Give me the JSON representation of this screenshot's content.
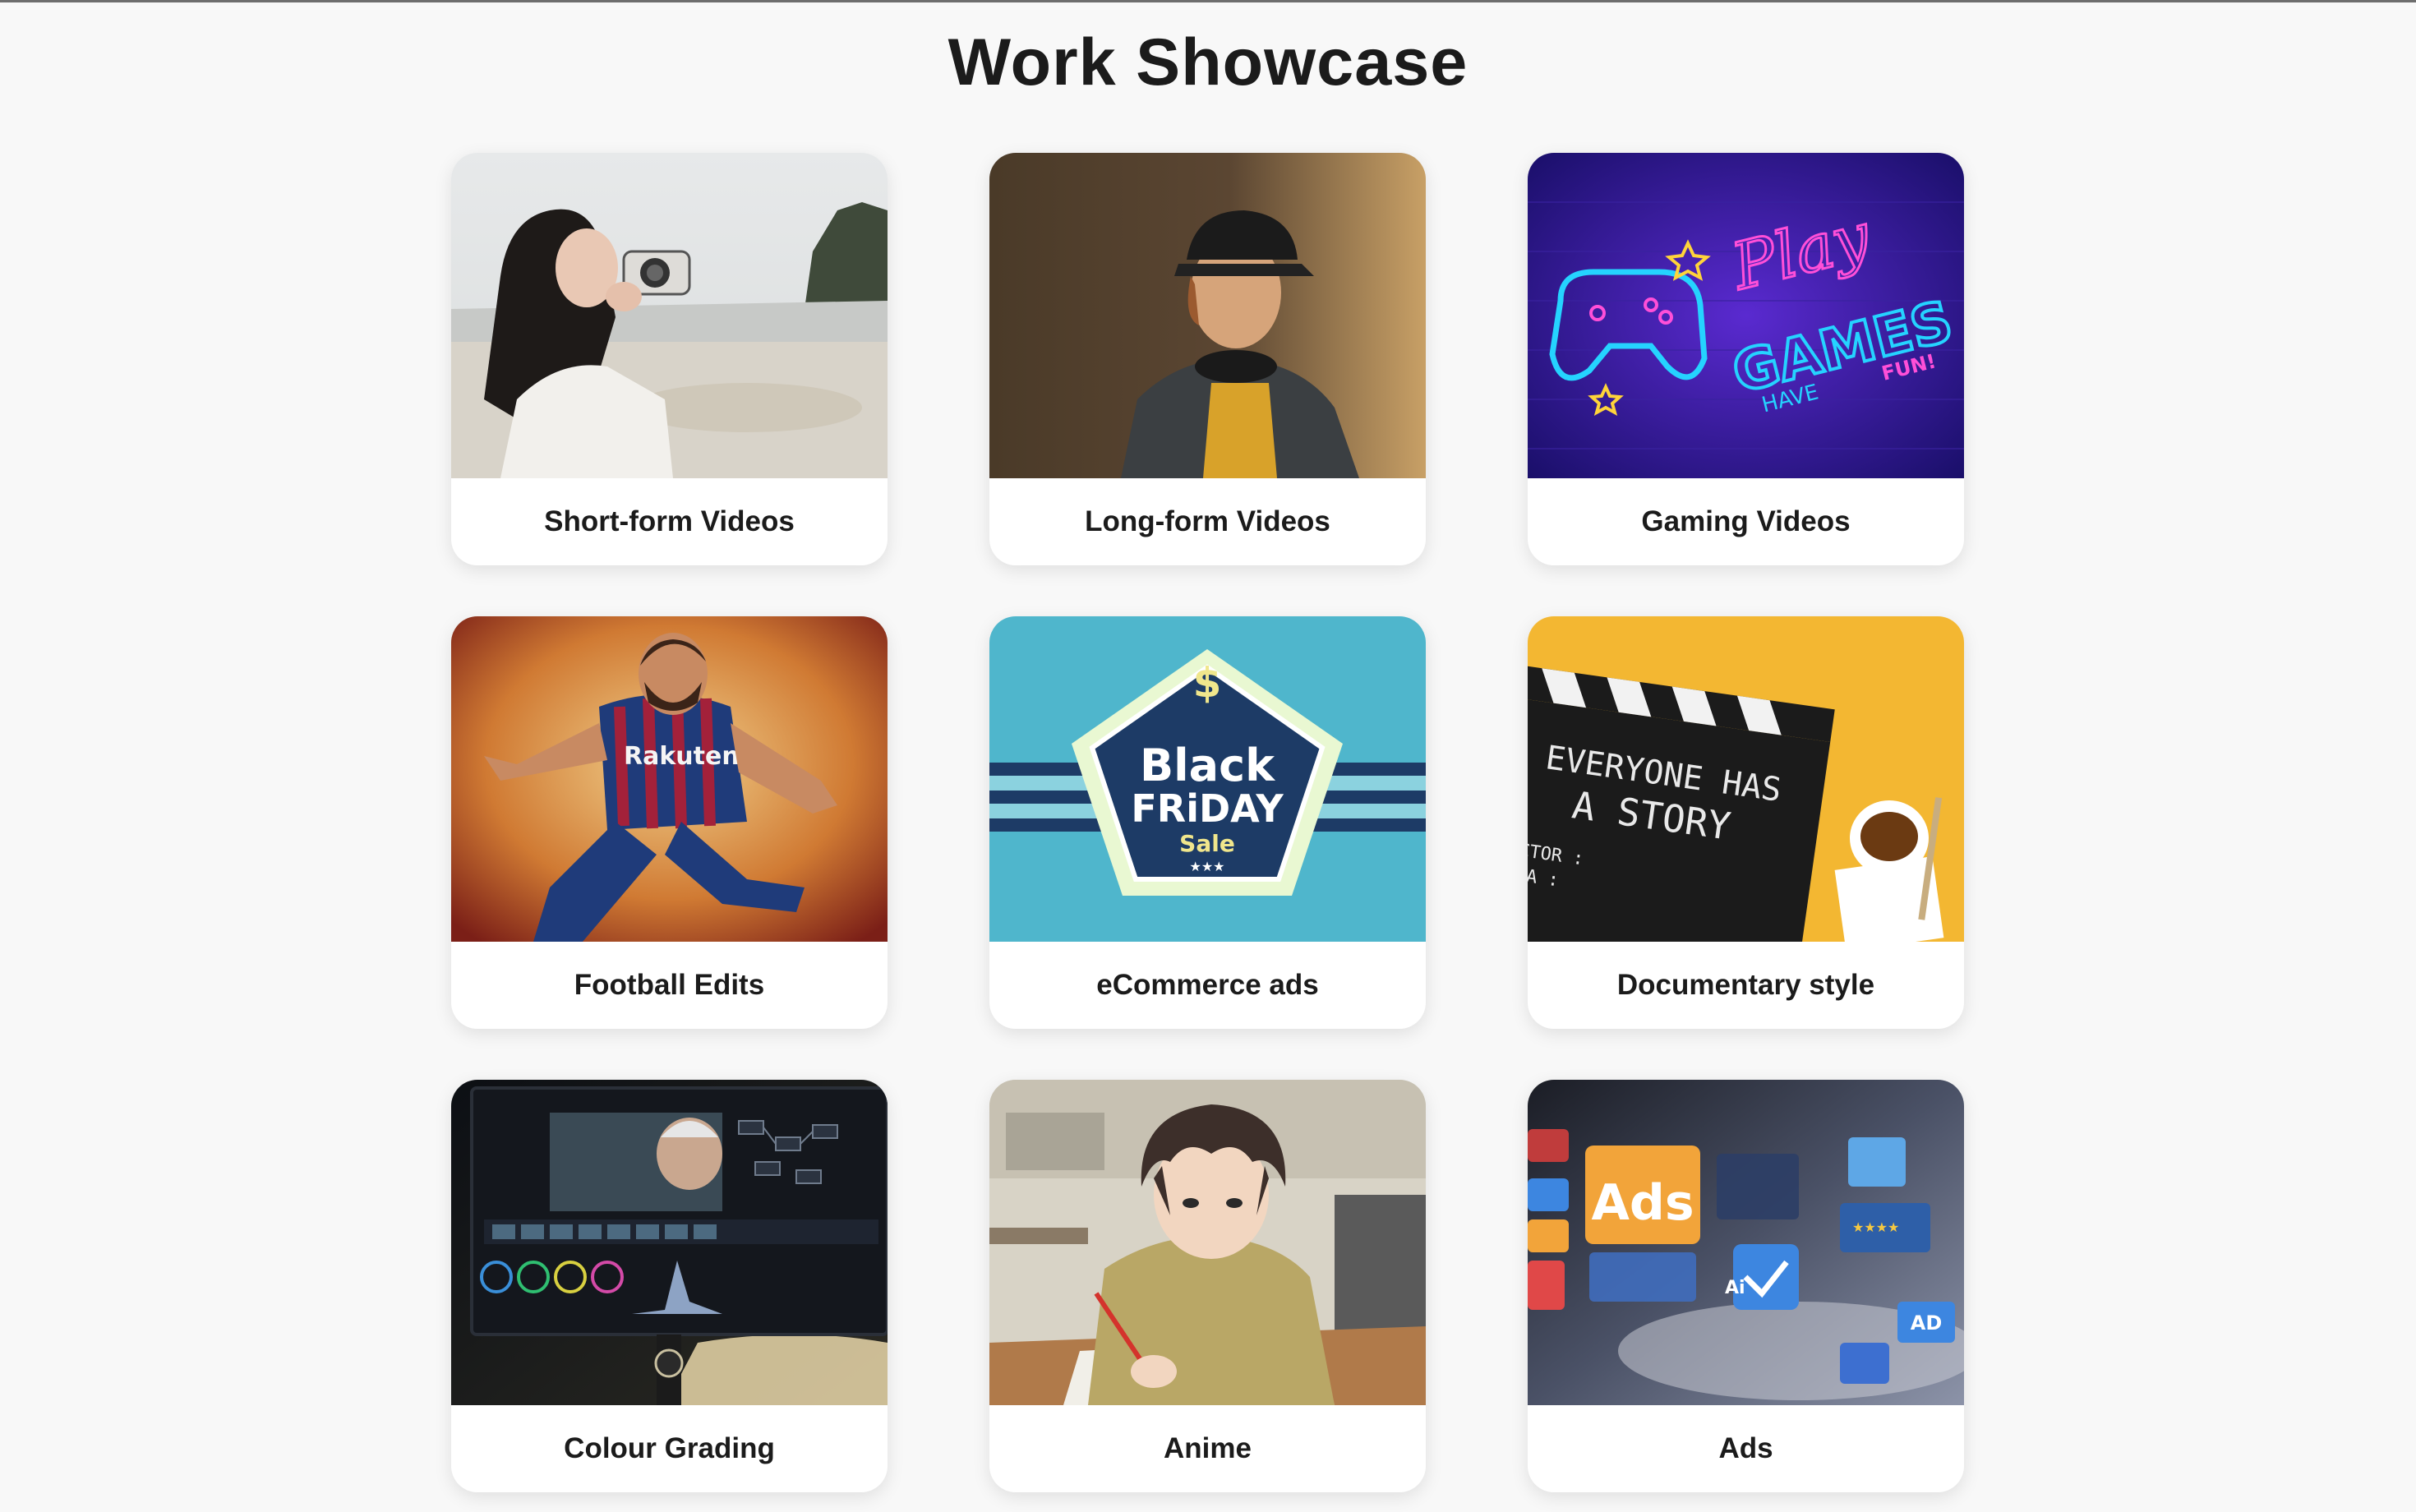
{
  "page": {
    "title": "Work Showcase"
  },
  "cards": [
    {
      "label": "Short-form Videos",
      "image": "woman-with-camera-on-beach"
    },
    {
      "label": "Long-form Videos",
      "image": "young-man-with-cap-and-headphones"
    },
    {
      "label": "Gaming Videos",
      "image": "neon-play-games-sign",
      "text": {
        "play": "Play",
        "games": "GAMES",
        "have": "HAVE",
        "fun": "FUN!"
      }
    },
    {
      "label": "Football Edits",
      "image": "footballer-illustration",
      "text": {
        "sponsor": "Rakuten"
      }
    },
    {
      "label": "eCommerce ads",
      "image": "black-friday-sale-badge",
      "text": {
        "line1": "Black",
        "line2": "FRiDAY",
        "line3": "Sale",
        "stars": "★★★",
        "dollar": "$"
      }
    },
    {
      "label": "Documentary style",
      "image": "clapperboard-everyone-has-a-story",
      "text": {
        "line1": "EVERYONE HAS",
        "line2": "A STORY",
        "director": "ECTOR :",
        "camera": "ERA :"
      }
    },
    {
      "label": "Colour Grading",
      "image": "color-grading-software-on-monitor"
    },
    {
      "label": "Anime",
      "image": "anime-boy-drawing"
    },
    {
      "label": "Ads",
      "image": "digital-ads-icons",
      "text": {
        "ads": "Ads",
        "ai": "Ai",
        "ad": "AD",
        "stars": "★★★★"
      }
    }
  ]
}
